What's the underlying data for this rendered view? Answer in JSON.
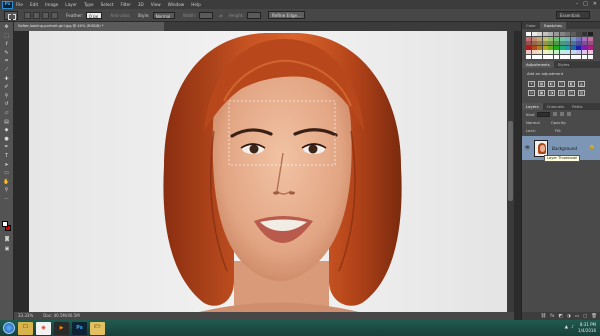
{
  "app": {
    "logo": "Ps"
  },
  "menu": [
    "File",
    "Edit",
    "Image",
    "Layer",
    "Type",
    "Select",
    "Filter",
    "3D",
    "View",
    "Window",
    "Help"
  ],
  "window_controls": [
    "–",
    "□",
    "✕"
  ],
  "options": {
    "feather_label": "Feather:",
    "feather_value": "0 px",
    "anti_alias": "Anti-alias",
    "style_label": "Style:",
    "style_value": "Normal",
    "width_label": "Width:",
    "height_label": "Height:",
    "refine_edge": "Refine Edge...",
    "workspace": "Essentials"
  },
  "document": {
    "tab_title": "Softer-looking-portrait-girl-jpg @ 40% (RGB/8) *",
    "zoom": "33.33%",
    "doc_size": "Doc: 40.5M/40.5M"
  },
  "panels": {
    "top_tabs": [
      "Color",
      "Swatches"
    ],
    "adj_tabs": [
      "Adjustments",
      "Styles"
    ],
    "adj_title": "Add an adjustment",
    "adj_icons": [
      "☀",
      "▦",
      "◐",
      "▽",
      "◧",
      "◭",
      "⚖",
      "▣",
      "◑",
      "▤",
      "◰",
      "▥"
    ],
    "layers_tabs": [
      "Layers",
      "Channels",
      "Paths"
    ],
    "filter_label": "Kind",
    "blend_mode": "Normal",
    "opacity_label": "Opacity:",
    "lock_label": "Lock:",
    "fill_label": "Fill:",
    "layer_name": "Background",
    "tooltip": "Layer Thumbnail",
    "bottom_icons": [
      "⛓",
      "fx",
      "◩",
      "◑",
      "▭",
      "▢",
      "🗑"
    ]
  },
  "taskbar": {
    "apps": [
      {
        "name": "explorer",
        "label": "🗀",
        "bg": "#d8b24b",
        "fg": "#5a3d00"
      },
      {
        "name": "chrome",
        "label": "◉",
        "bg": "#f2f2f2",
        "fg": "#d93025"
      },
      {
        "name": "media",
        "label": "▶",
        "bg": "#2a2a2a",
        "fg": "#ff8a00"
      },
      {
        "name": "photoshop",
        "label": "Ps",
        "bg": "#0e2233",
        "fg": "#31a8ff"
      },
      {
        "name": "folder",
        "label": "🗁",
        "bg": "#e0c060",
        "fg": "#6a4800"
      }
    ],
    "time": "8:31 PM",
    "date": "1/4/2016"
  },
  "colors": {
    "fg_swatch": "#ffffff",
    "bg_swatch": "#d40000",
    "layer_selected": "#7d96b6"
  }
}
